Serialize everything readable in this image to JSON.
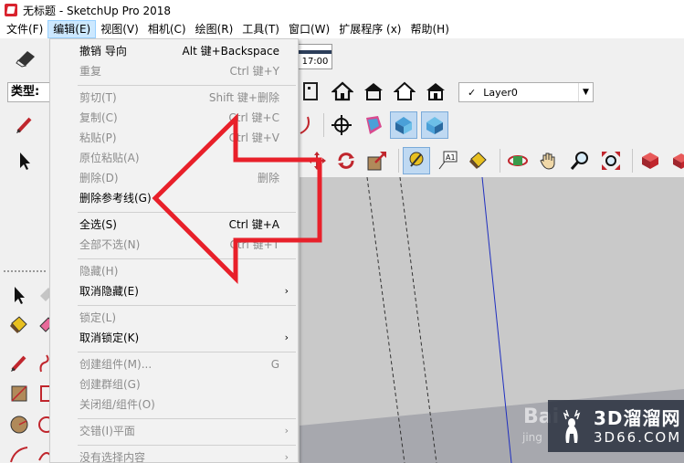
{
  "window": {
    "title": "无标题 - SketchUp Pro 2018"
  },
  "menubar": {
    "items": [
      "文件(F)",
      "编辑(E)",
      "视图(V)",
      "相机(C)",
      "绘图(R)",
      "工具(T)",
      "窗口(W)",
      "扩展程序 (x)",
      "帮助(H)"
    ],
    "active_index": 1
  },
  "toolbar": {
    "type_label": "类型:",
    "clock_time": "17:00",
    "layer": {
      "check": "✓",
      "name": "Layer0"
    }
  },
  "edit_menu": {
    "items": [
      {
        "label": "撤销 导向",
        "shortcut": "Alt 键+Backspace",
        "enabled": true
      },
      {
        "label": "重复",
        "shortcut": "Ctrl 键+Y",
        "enabled": false
      },
      {
        "label": "剪切(T)",
        "shortcut": "Shift 键+删除",
        "enabled": false
      },
      {
        "label": "复制(C)",
        "shortcut": "Ctrl 键+C",
        "enabled": false
      },
      {
        "label": "粘贴(P)",
        "shortcut": "Ctrl 键+V",
        "enabled": false
      },
      {
        "label": "原位粘贴(A)",
        "shortcut": "",
        "enabled": false
      },
      {
        "label": "删除(D)",
        "shortcut": "删除",
        "enabled": false
      },
      {
        "label": "删除参考线(G)",
        "shortcut": "",
        "enabled": true
      },
      {
        "label": "全选(S)",
        "shortcut": "Ctrl 键+A",
        "enabled": true
      },
      {
        "label": "全部不选(N)",
        "shortcut": "Ctrl 键+T",
        "enabled": false
      },
      {
        "label": "隐藏(H)",
        "shortcut": "",
        "enabled": false
      },
      {
        "label": "取消隐藏(E)",
        "shortcut": "",
        "enabled": true,
        "submenu": "›"
      },
      {
        "label": "锁定(L)",
        "shortcut": "",
        "enabled": false
      },
      {
        "label": "取消锁定(K)",
        "shortcut": "",
        "enabled": true,
        "submenu": "›"
      },
      {
        "label": "创建组件(M)...",
        "shortcut": "G",
        "enabled": false
      },
      {
        "label": "创建群组(G)",
        "shortcut": "",
        "enabled": false
      },
      {
        "label": "关闭组/组件(O)",
        "shortcut": "",
        "enabled": false
      },
      {
        "label": "交错(I)平面",
        "shortcut": "",
        "enabled": false,
        "submenu": "›"
      },
      {
        "label": "没有选择内容",
        "shortcut": "",
        "enabled": false,
        "submenu": "›"
      }
    ]
  },
  "watermark": {
    "main": "3D溜溜网",
    "sub": "3D66.COM",
    "baidu": "Bai",
    "baidu_sub": "jing"
  },
  "colors": {
    "arrow": "#e8202a",
    "menu_highlight": "#cce8ff",
    "viewport": "#c9c9c9"
  }
}
